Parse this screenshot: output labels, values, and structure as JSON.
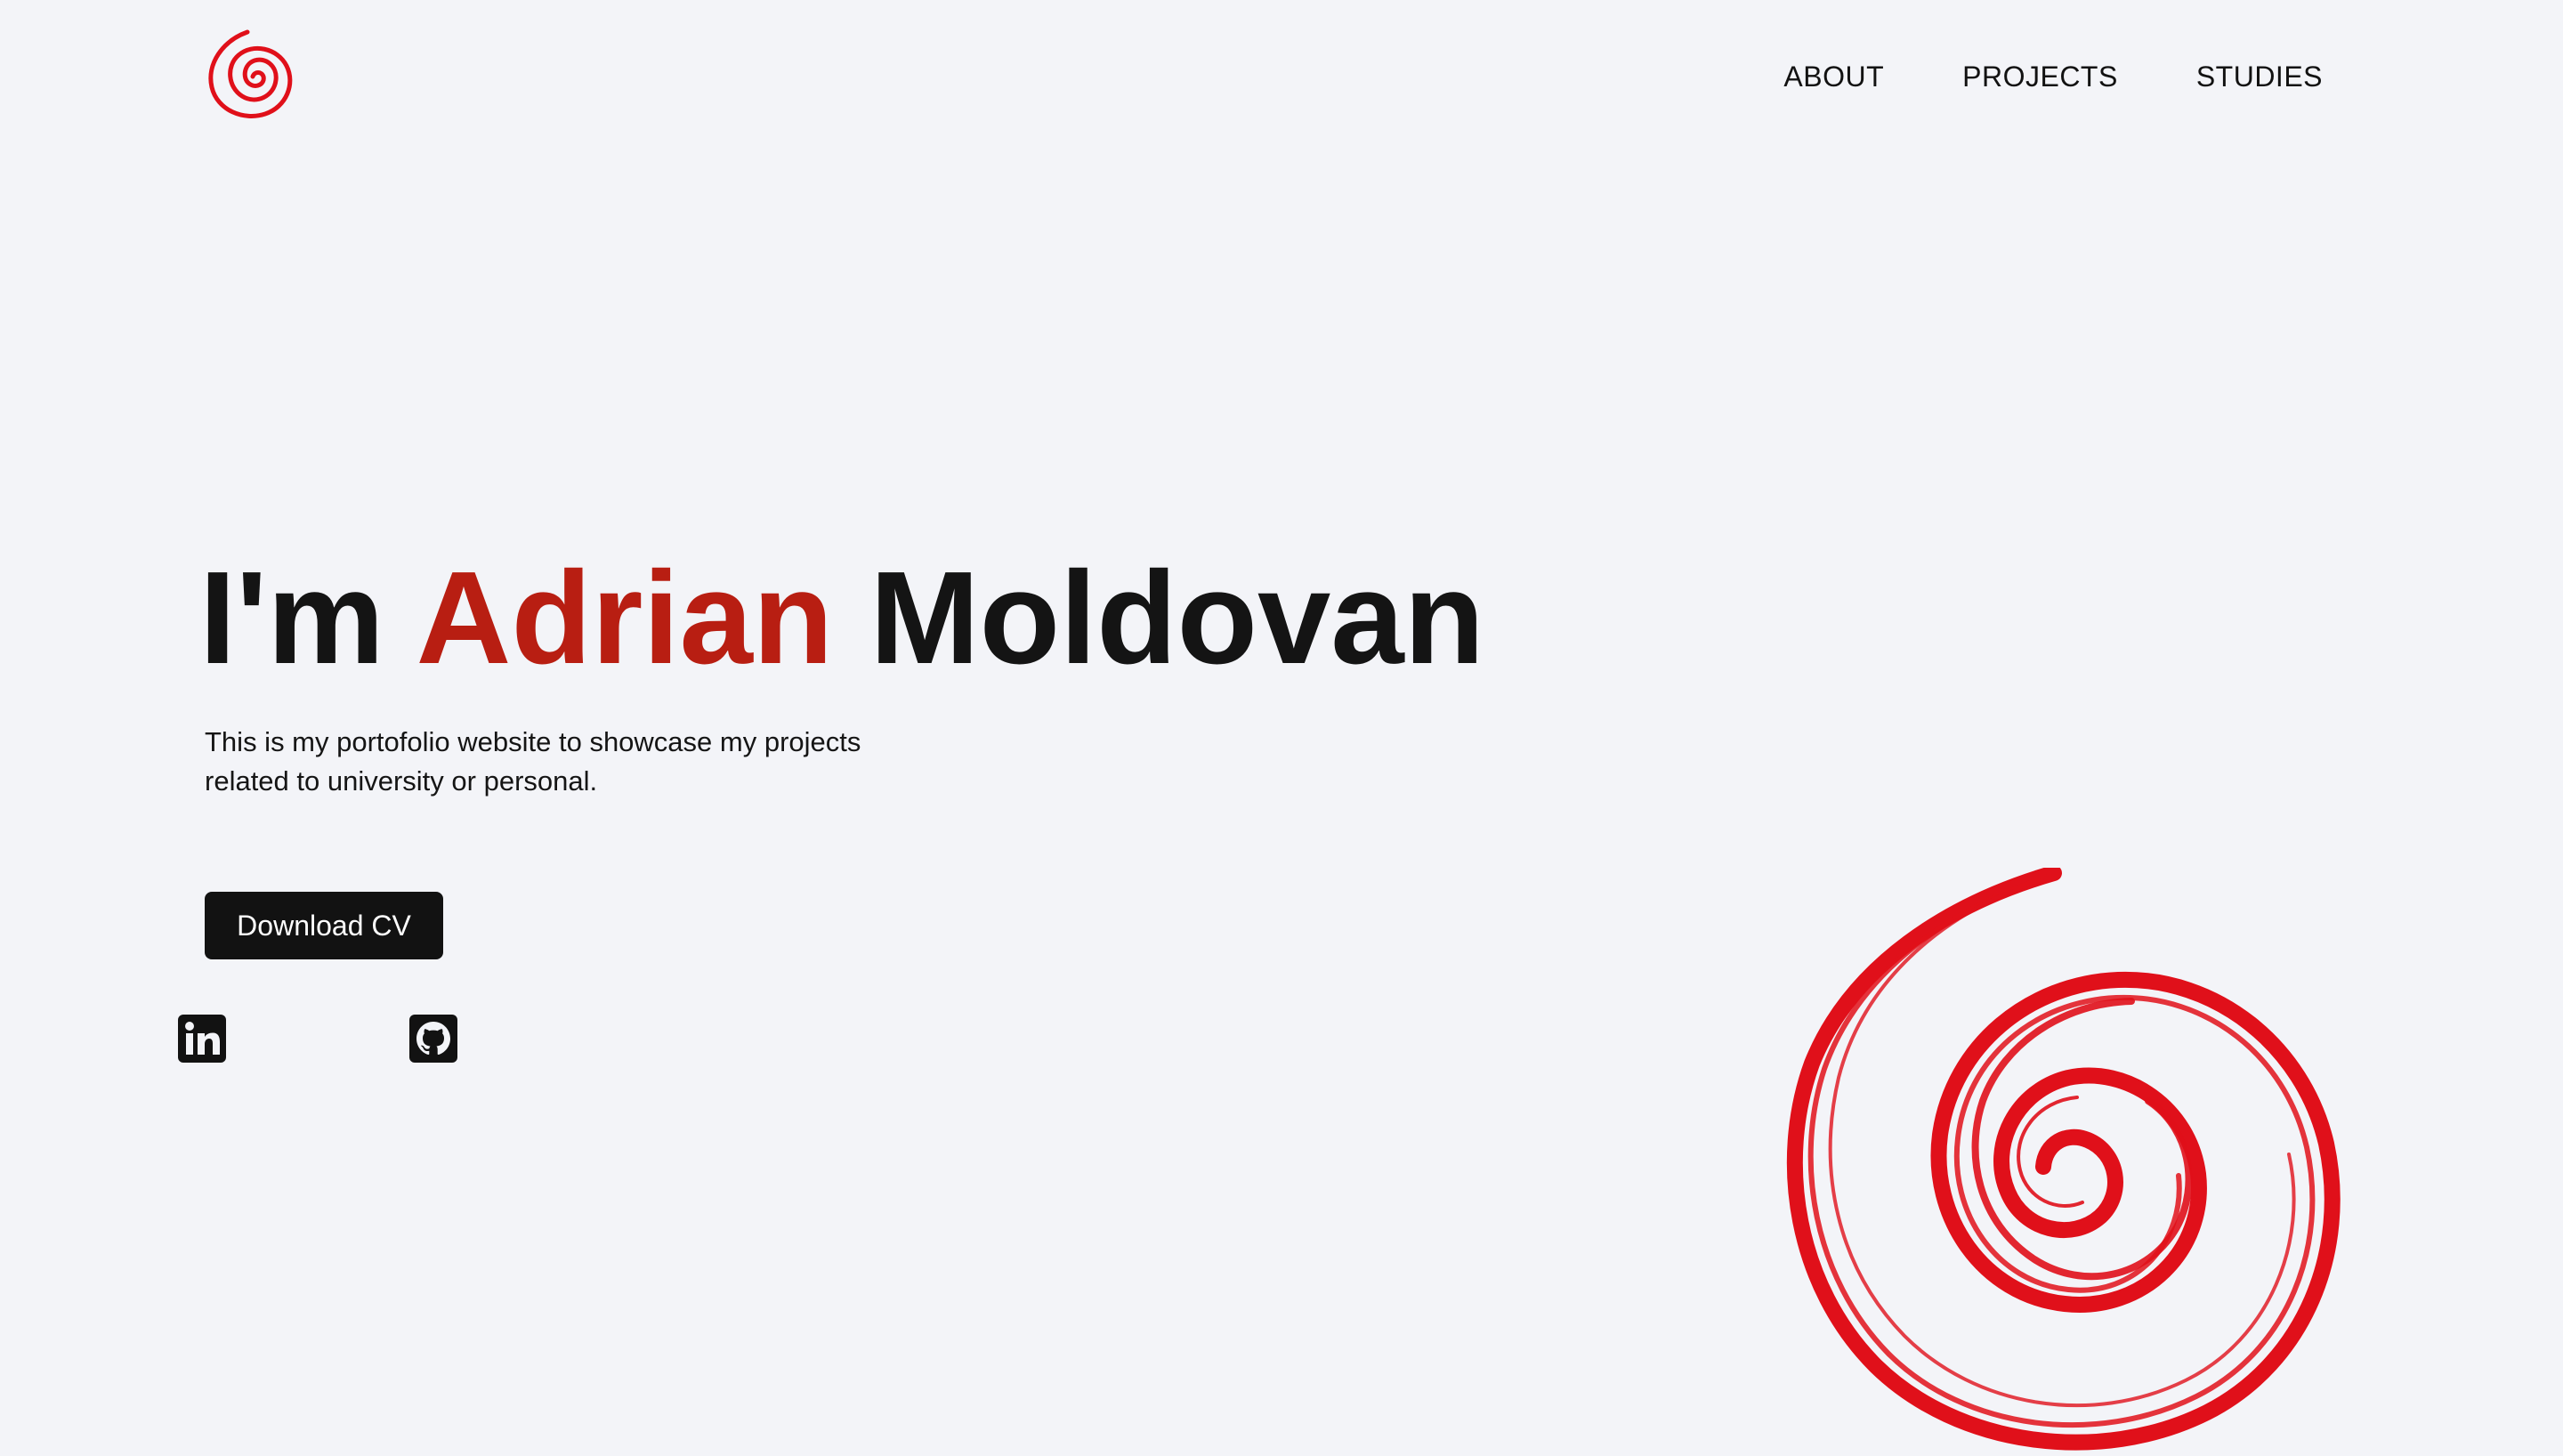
{
  "header": {
    "logo_icon": "red-spiral-logo-icon",
    "nav": [
      {
        "label": "ABOUT"
      },
      {
        "label": "PROJECTS"
      },
      {
        "label": "STUDIES"
      }
    ]
  },
  "hero": {
    "title_prefix": "I'm ",
    "title_accent": "Adrian",
    "title_suffix": " Moldovan",
    "description": "This is my portofolio website to showcase my projects related to university or personal.",
    "cv_button_label": "Download CV"
  },
  "social": [
    {
      "icon": "linkedin-icon"
    },
    {
      "icon": "github-icon"
    }
  ],
  "decoration": {
    "icon": "red-spiral-art"
  },
  "colors": {
    "background": "#f3f4f8",
    "accent": "#b81e12",
    "spiral": "#e0101a",
    "text": "#121212",
    "button_bg": "#121212",
    "button_text": "#ffffff"
  }
}
